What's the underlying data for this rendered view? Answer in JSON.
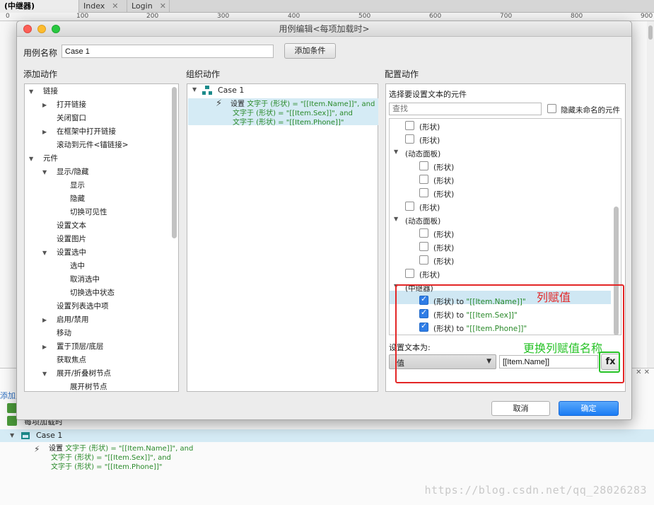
{
  "tabs": [
    {
      "label": "(中继器)(Index)",
      "active": true
    },
    {
      "label": "Index",
      "active": false
    },
    {
      "label": "Login",
      "active": false
    }
  ],
  "ruler": [
    "0",
    "100",
    "200",
    "300",
    "400",
    "500",
    "600",
    "700",
    "800",
    "900"
  ],
  "dialog": {
    "title": "用例编辑<每项加载时>",
    "case_name_label": "用例名称",
    "case_name_value": "Case 1",
    "add_condition": "添加条件",
    "add_action_title": "添加动作",
    "organize_action_title": "组织动作",
    "config_action_title": "配置动作",
    "actions_tree": [
      {
        "label": "链接",
        "level": 0,
        "arrow": "down"
      },
      {
        "label": "打开链接",
        "level": 1,
        "arrow": "right"
      },
      {
        "label": "关闭窗口",
        "level": 1,
        "arrow": ""
      },
      {
        "label": "在框架中打开链接",
        "level": 1,
        "arrow": "right"
      },
      {
        "label": "滚动到元件<锚链接>",
        "level": 1,
        "arrow": ""
      },
      {
        "label": "元件",
        "level": 0,
        "arrow": "down"
      },
      {
        "label": "显示/隐藏",
        "level": 1,
        "arrow": "down"
      },
      {
        "label": "显示",
        "level": 2,
        "arrow": ""
      },
      {
        "label": "隐藏",
        "level": 2,
        "arrow": ""
      },
      {
        "label": "切换可见性",
        "level": 2,
        "arrow": ""
      },
      {
        "label": "设置文本",
        "level": 1,
        "arrow": ""
      },
      {
        "label": "设置图片",
        "level": 1,
        "arrow": ""
      },
      {
        "label": "设置选中",
        "level": 1,
        "arrow": "down"
      },
      {
        "label": "选中",
        "level": 2,
        "arrow": ""
      },
      {
        "label": "取消选中",
        "level": 2,
        "arrow": ""
      },
      {
        "label": "切换选中状态",
        "level": 2,
        "arrow": ""
      },
      {
        "label": "设置列表选中项",
        "level": 1,
        "arrow": ""
      },
      {
        "label": "启用/禁用",
        "level": 1,
        "arrow": "right"
      },
      {
        "label": "移动",
        "level": 1,
        "arrow": ""
      },
      {
        "label": "置于顶层/底层",
        "level": 1,
        "arrow": "right"
      },
      {
        "label": "获取焦点",
        "level": 1,
        "arrow": ""
      },
      {
        "label": "展开/折叠树节点",
        "level": 1,
        "arrow": "down"
      },
      {
        "label": "展开树节点",
        "level": 2,
        "arrow": ""
      }
    ],
    "organize": {
      "case_label": "Case 1",
      "action_prefix": "设置",
      "action_lines": [
        "文字于 (形状) = \"[[Item.Name]]\", and",
        "文字于 (形状) = \"[[Item.Sex]]\", and",
        "文字于 (形状) = \"[[Item.Phone]]\""
      ]
    },
    "config": {
      "select_widget_label": "选择要设置文本的元件",
      "search_placeholder": "查找",
      "hide_unnamed": "隐藏未命名的元件",
      "widgets": [
        {
          "type": "check",
          "indent": 1,
          "label": "(形状)",
          "checked": false
        },
        {
          "type": "check",
          "indent": 1,
          "label": "(形状)",
          "checked": false
        },
        {
          "type": "group",
          "indent": 0,
          "label": "(动态面板)"
        },
        {
          "type": "check",
          "indent": 2,
          "label": "(形状)",
          "checked": false
        },
        {
          "type": "check",
          "indent": 2,
          "label": "(形状)",
          "checked": false
        },
        {
          "type": "check",
          "indent": 2,
          "label": "(形状)",
          "checked": false
        },
        {
          "type": "check",
          "indent": 1,
          "label": "(形状)",
          "checked": false
        },
        {
          "type": "group",
          "indent": 0,
          "label": "(动态面板)"
        },
        {
          "type": "check",
          "indent": 2,
          "label": "(形状)",
          "checked": false
        },
        {
          "type": "check",
          "indent": 2,
          "label": "(形状)",
          "checked": false
        },
        {
          "type": "check",
          "indent": 2,
          "label": "(形状)",
          "checked": false
        },
        {
          "type": "check",
          "indent": 1,
          "label": "(形状)",
          "checked": false
        },
        {
          "type": "group",
          "indent": 0,
          "label": "(中继器)"
        },
        {
          "type": "check",
          "indent": 2,
          "label": "(形状) to ",
          "value": "\"[[Item.Name]]\"",
          "checked": true,
          "selected": true
        },
        {
          "type": "check",
          "indent": 2,
          "label": "(形状) to ",
          "value": "\"[[Item.Sex]]\"",
          "checked": true
        },
        {
          "type": "check",
          "indent": 2,
          "label": "(形状) to ",
          "value": "\"[[Item.Phone]]\"",
          "checked": true
        }
      ],
      "set_text_label": "设置文本为:",
      "type_select": "值",
      "value_input": "[[Item.Name]]",
      "fx_label": "fx"
    },
    "cancel": "取消",
    "ok": "确定"
  },
  "annotations": {
    "red": "列赋值",
    "green": "更换列赋值名称"
  },
  "bottom": {
    "add_label": "添加用",
    "event_label": "每项加载时",
    "case_label": "Case 1",
    "action_prefix": "设置",
    "action_lines": [
      "文字于 (形状) = \"[[Item.Name]]\", and",
      "文字于 (形状) = \"[[Item.Sex]]\", and",
      "文字于 (形状) = \"[[Item.Phone]]\""
    ]
  },
  "watermark": "https://blog.csdn.net/qq_28026283"
}
